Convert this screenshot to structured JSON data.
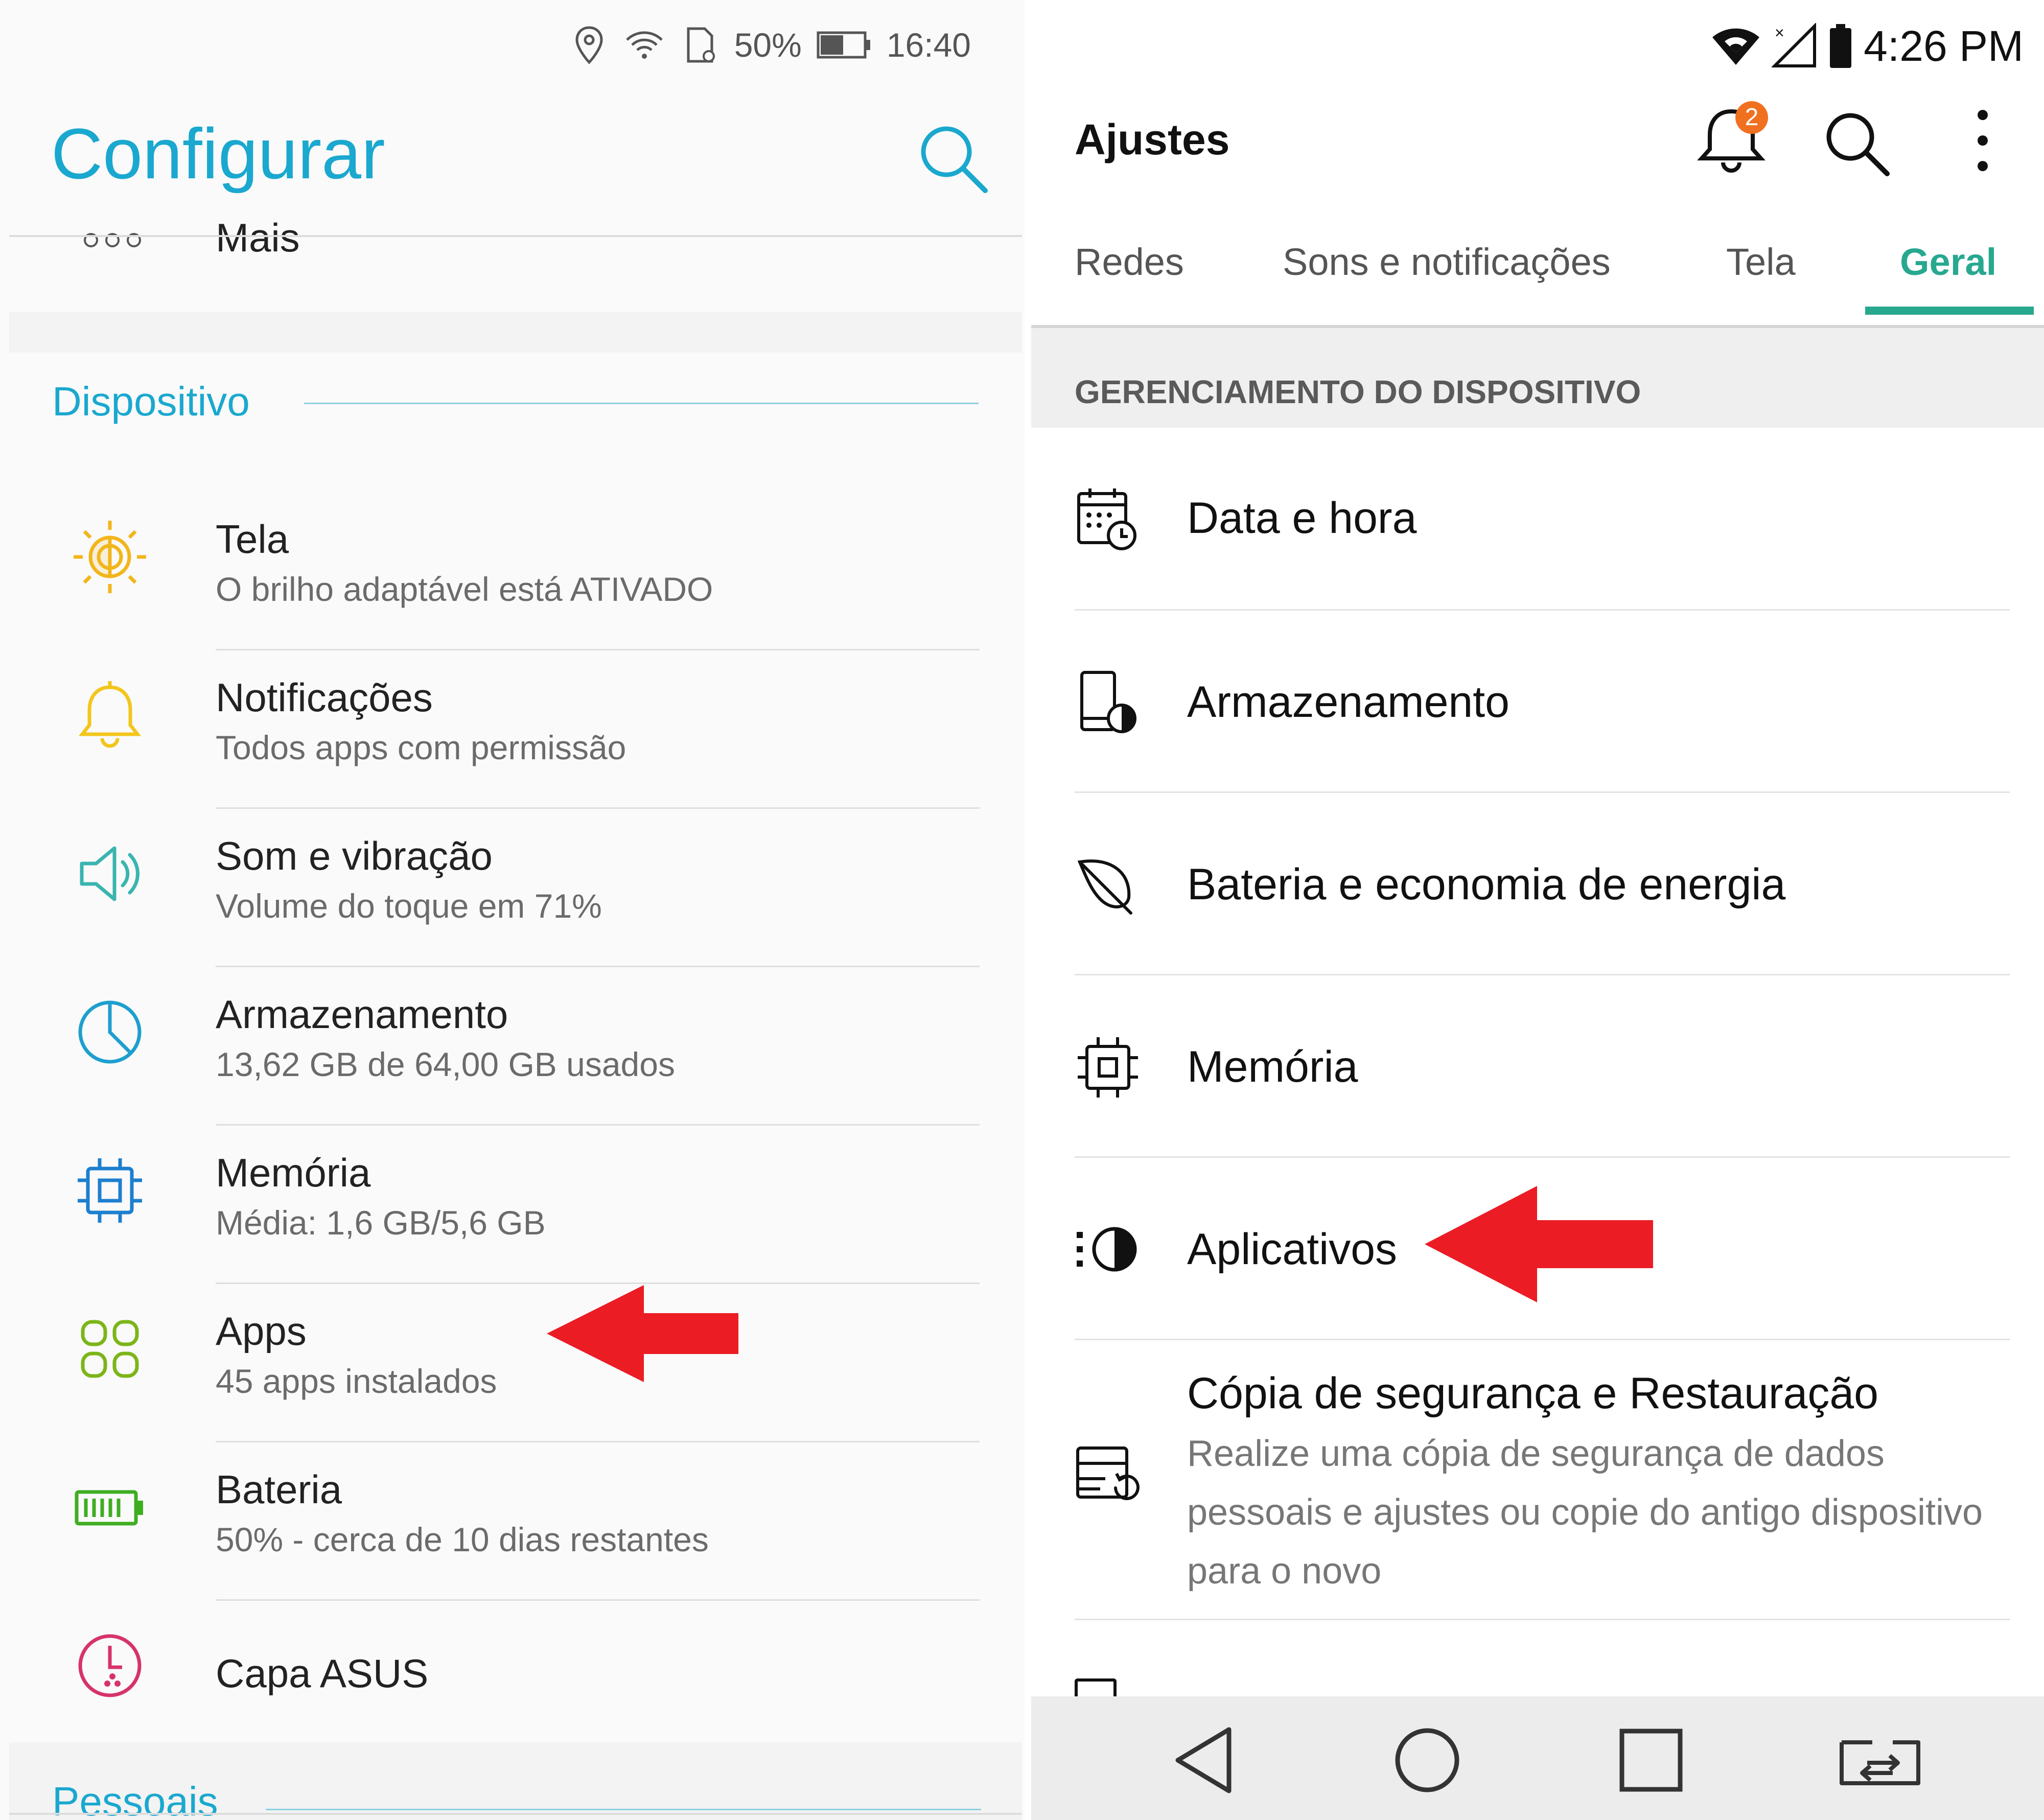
{
  "left": {
    "status": {
      "battery": "50%",
      "time": "16:40",
      "icons": [
        "location-icon",
        "wifi-icon",
        "sd-card-icon",
        "battery-icon"
      ]
    },
    "title": "Configurar",
    "top_item": "Mais",
    "section": "Dispositivo",
    "items": [
      {
        "title": "Tela",
        "subtitle": "O brilho adaptável está ATIVADO",
        "icon": "brightness-icon",
        "color": "#f2b61c"
      },
      {
        "title": "Notificações",
        "subtitle": "Todos apps com permissão",
        "icon": "bell-icon",
        "color": "#f2c61c"
      },
      {
        "title": "Som e vibração",
        "subtitle": "Volume do toque em 71%",
        "icon": "speaker-icon",
        "color": "#3ab5b0"
      },
      {
        "title": "Armazenamento",
        "subtitle": "13,62 GB de 64,00 GB usados",
        "icon": "storage-pie-icon",
        "color": "#1d9fcf"
      },
      {
        "title": "Memória",
        "subtitle": "Média: 1,6 GB/5,6 GB",
        "icon": "chip-icon",
        "color": "#1d7fcf"
      },
      {
        "title": "Apps",
        "subtitle": "45 apps instalados",
        "icon": "apps-grid-icon",
        "color": "#7cb518"
      },
      {
        "title": "Bateria",
        "subtitle": "50% - cerca de 10 dias restantes",
        "icon": "battery-full-icon",
        "color": "#3fad22"
      },
      {
        "title": "Capa ASUS",
        "subtitle": "",
        "icon": "cover-clock-icon",
        "color": "#d6336c"
      }
    ],
    "bottom_section": "Pessoais"
  },
  "right": {
    "status": {
      "time": "4:26 PM",
      "icons": [
        "wifi-icon",
        "signal-icon",
        "battery-icon"
      ]
    },
    "title": "Ajustes",
    "notification_count": "2",
    "tabs": [
      {
        "label": "Redes",
        "active": false
      },
      {
        "label": "Sons e notificações",
        "active": false
      },
      {
        "label": "Tela",
        "active": false
      },
      {
        "label": "Geral",
        "active": true
      }
    ],
    "section": "GERENCIAMENTO DO DISPOSITIVO",
    "items": [
      {
        "title": "Data e hora",
        "description": "",
        "icon": "calendar-clock-icon"
      },
      {
        "title": "Armazenamento",
        "description": "",
        "icon": "phone-storage-icon"
      },
      {
        "title": "Bateria e economia de energia",
        "description": "",
        "icon": "leaf-icon"
      },
      {
        "title": "Memória",
        "description": "",
        "icon": "chip-icon"
      },
      {
        "title": "Aplicativos",
        "description": "",
        "icon": "apps-icon"
      },
      {
        "title": "Cópia de segurança e Restauração",
        "description": "Realize uma cópia de segurança de dados pessoais e ajustes ou copie do antigo dispositivo para o novo",
        "icon": "backup-icon"
      }
    ],
    "nav": [
      "back-icon",
      "home-icon",
      "recents-icon",
      "switch-icon"
    ]
  },
  "colors": {
    "asus_accent": "#1aa8cf",
    "lg_accent": "#27a88f",
    "arrow": "#ec1c24",
    "badge": "#f07020"
  }
}
